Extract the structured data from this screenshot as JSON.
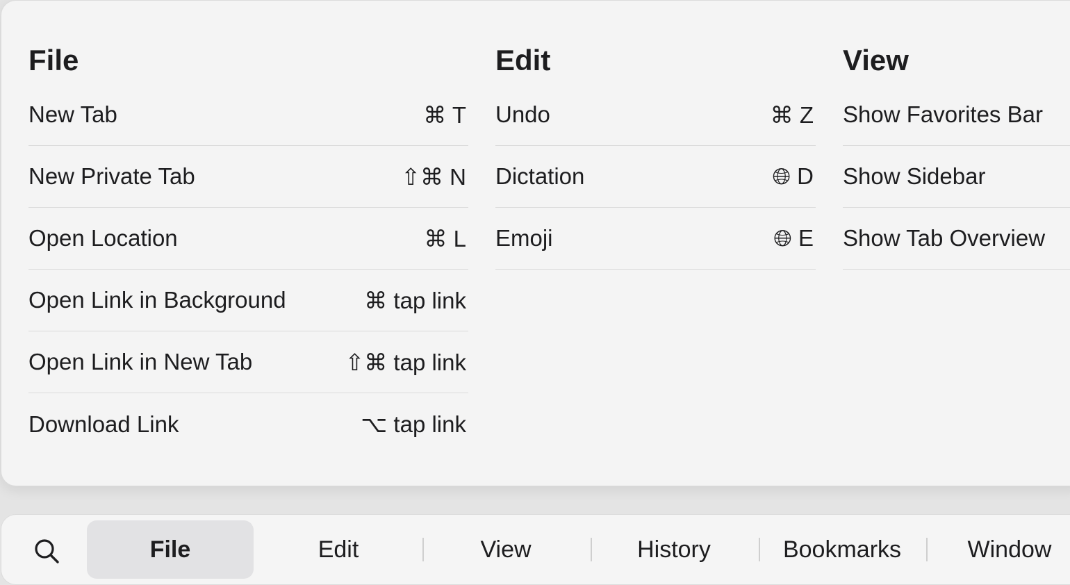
{
  "menus": {
    "file": {
      "title": "File",
      "items": [
        {
          "label": "New Tab",
          "shortcut": "⌘ T"
        },
        {
          "label": "New Private Tab",
          "shortcut": "⇧⌘ N"
        },
        {
          "label": "Open Location",
          "shortcut": "⌘ L"
        },
        {
          "label": "Open Link in Background",
          "shortcut": "⌘ tap link"
        },
        {
          "label": "Open Link in New Tab",
          "shortcut": "⇧⌘ tap link"
        },
        {
          "label": "Download Link",
          "shortcut": "⌥ tap link"
        }
      ]
    },
    "edit": {
      "title": "Edit",
      "items": [
        {
          "label": "Undo",
          "shortcut": "⌘ Z"
        },
        {
          "label": "Dictation",
          "shortcut": "🌐︎ D"
        },
        {
          "label": "Emoji",
          "shortcut": "🌐︎ E"
        }
      ]
    },
    "view": {
      "title": "View",
      "items": [
        {
          "label": "Show Favorites Bar"
        },
        {
          "label": "Show Sidebar"
        },
        {
          "label": "Show Tab Overview"
        }
      ]
    }
  },
  "menubar": {
    "search_icon": "search-icon",
    "tabs": [
      {
        "label": "File",
        "active": true
      },
      {
        "label": "Edit"
      },
      {
        "label": "View"
      },
      {
        "label": "History"
      },
      {
        "label": "Bookmarks"
      },
      {
        "label": "Window"
      }
    ]
  }
}
